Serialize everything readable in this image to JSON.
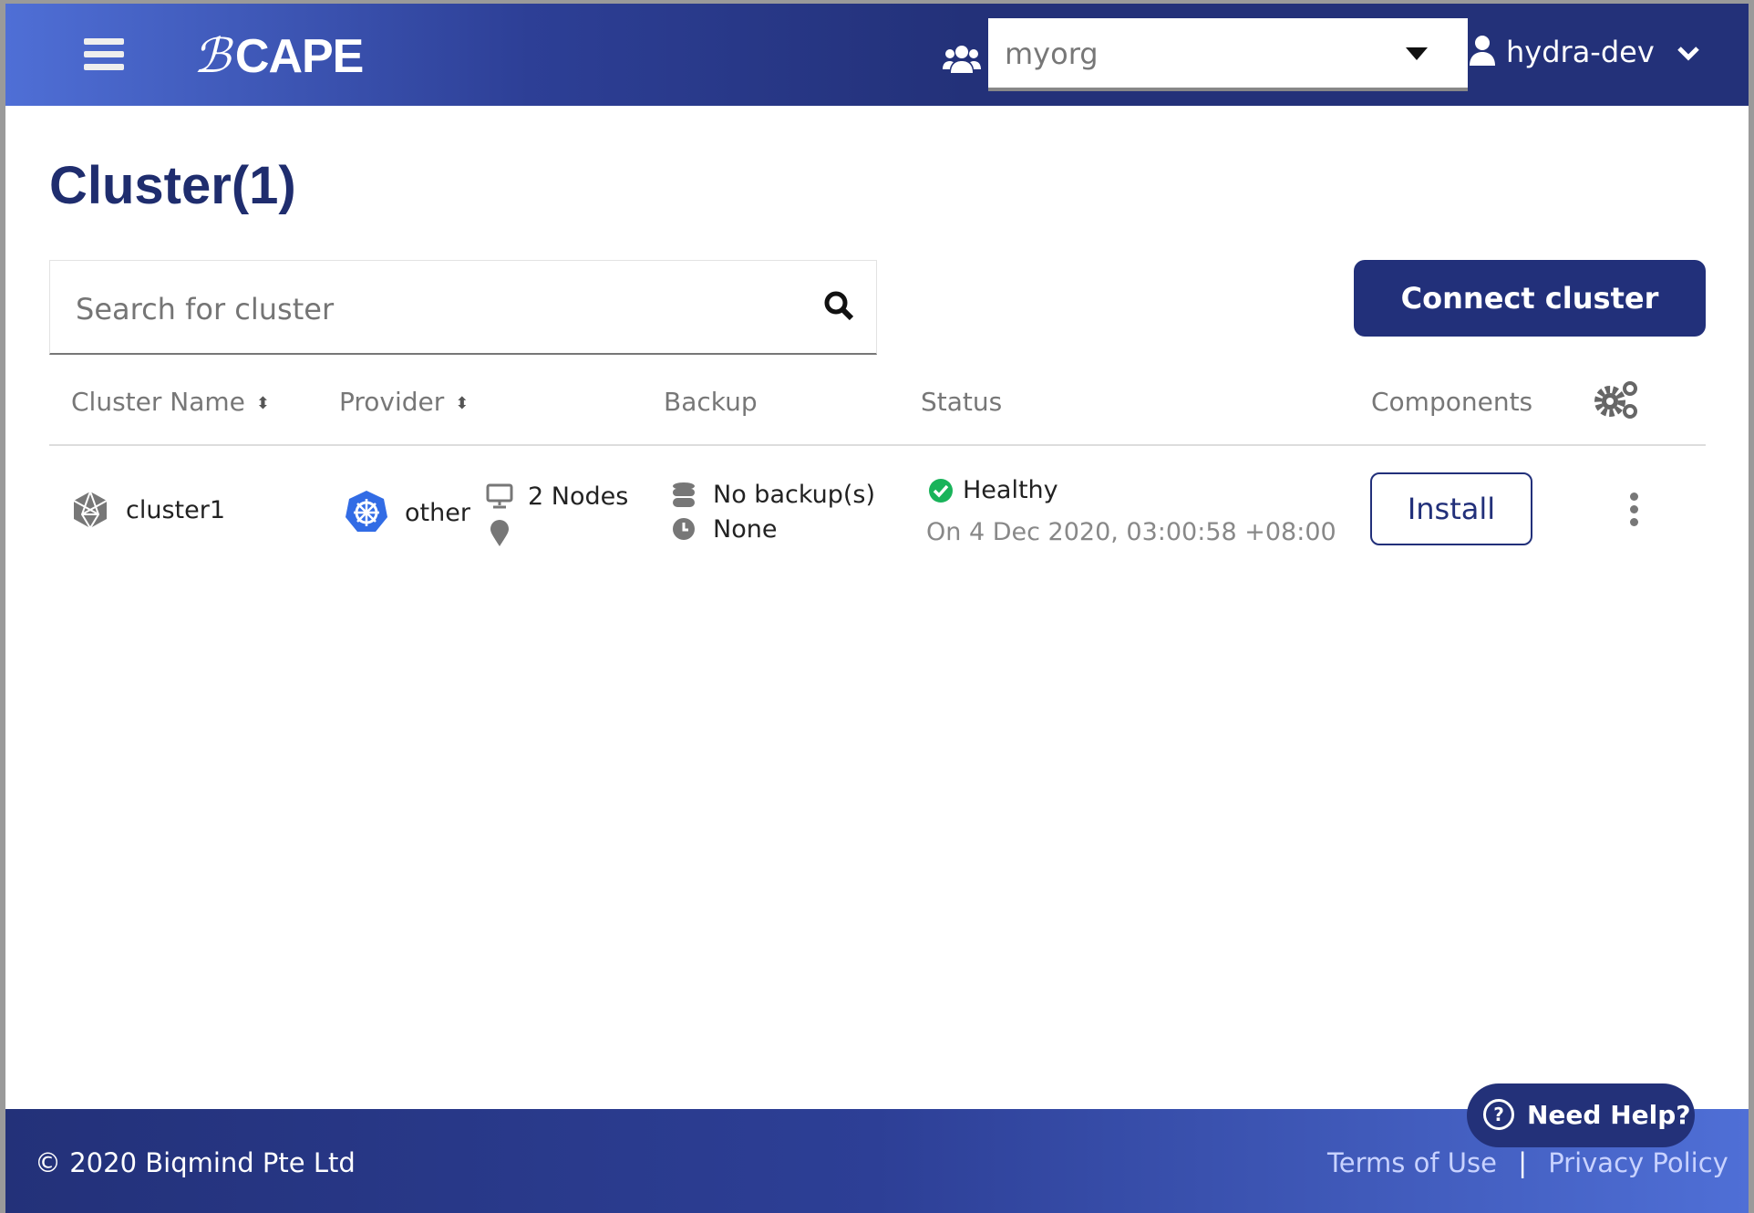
{
  "header": {
    "logo": "CAPE",
    "org_select": "myorg",
    "user": "hydra-dev"
  },
  "page_title": "Cluster(1)",
  "search": {
    "placeholder": "Search for cluster"
  },
  "connect_button": "Connect cluster",
  "table": {
    "columns": [
      "Cluster Name",
      "Provider",
      "Backup",
      "Status",
      "Components"
    ],
    "rows": [
      {
        "name": "cluster1",
        "provider": "other",
        "nodes": "2 Nodes",
        "backup": "No backup(s)",
        "backup_time": "None",
        "status": "Healthy",
        "status_time": "On 4 Dec 2020, 03:00:58 +08:00",
        "action": "Install"
      }
    ]
  },
  "help_button": "Need Help?",
  "footer": {
    "copyright": "© 2020 Biqmind Pte Ltd",
    "terms": "Terms of Use",
    "separator": "|",
    "privacy": "Privacy Policy"
  },
  "colors": {
    "primary": "#22307a",
    "healthy": "#19b35a",
    "kubernetes": "#326ce5"
  }
}
